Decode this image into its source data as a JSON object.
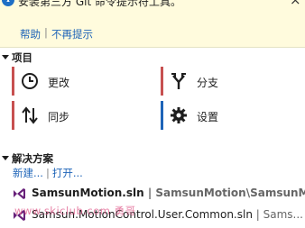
{
  "notice": {
    "message": "安装第三方 Git 命令提示符工具。",
    "close_glyph": "×",
    "help_link": "帮助",
    "separator": "|",
    "never_show_link": "不再提示"
  },
  "project": {
    "heading": "项目",
    "tiles": [
      {
        "label": "更改",
        "icon": "clock-icon",
        "accent": "#c75050"
      },
      {
        "label": "分支",
        "icon": "branch-icon",
        "accent": "#c75050"
      },
      {
        "label": "同步",
        "icon": "sync-arrows-icon",
        "accent": "#c75050"
      },
      {
        "label": "设置",
        "icon": "gear-icon",
        "accent": "#1e64b8"
      }
    ]
  },
  "solutions": {
    "heading": "解决方案",
    "new_link": "新建...",
    "separator": "|",
    "open_link": "打开...",
    "items": [
      {
        "name": "SamsunMotion.sln",
        "path": "SamsunMotion\\SamsunMo..."
      },
      {
        "name": "Samsun.MotionControl.User.Common.sln",
        "path": "Sams..."
      }
    ]
  },
  "watermark": "www.skiclub.com 勇哥",
  "colors": {
    "notice_bg": "#fffbdd",
    "link": "#1e64b8",
    "accent_red": "#c75050",
    "accent_blue": "#1e64b8",
    "vs_purple": "#68217a"
  }
}
